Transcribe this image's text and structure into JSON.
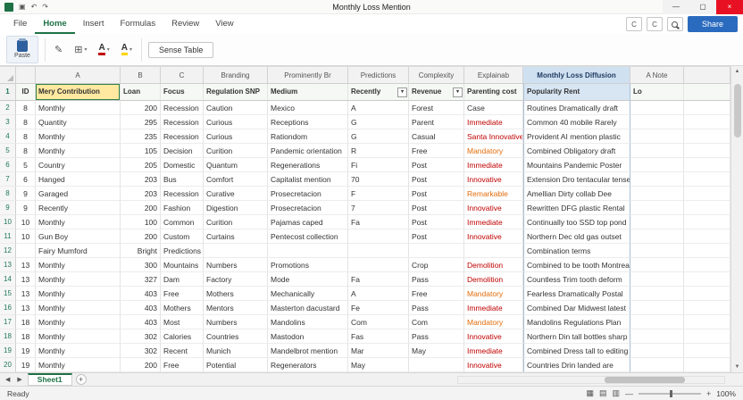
{
  "window": {
    "title": "Monthly Loss Mention",
    "minimize": "—",
    "maximize": "▢",
    "close": "×",
    "icons": {
      "save": "▣",
      "undo": "↶",
      "redo": "↷"
    }
  },
  "menu": {
    "tabs": [
      {
        "label": "File"
      },
      {
        "label": "Home",
        "active": true
      },
      {
        "label": "Insert"
      },
      {
        "label": "Formulas"
      },
      {
        "label": "Review"
      },
      {
        "label": "View"
      }
    ],
    "account_label": "C",
    "comments_label": "C",
    "share_label": "Share"
  },
  "ribbon": {
    "paste_label": "Paste",
    "tools_label": "Sense Table",
    "brush_glyph": "✎",
    "grid_glyph": "⊞",
    "font_glyph": "A",
    "dropdown_glyph": "▾"
  },
  "grid": {
    "filter_glyph": "▾",
    "filters": [
      "g",
      "h"
    ],
    "columns": [
      {
        "key": "gutter",
        "cls": "cg",
        "strip": ""
      },
      {
        "key": "a",
        "cls": "c-id",
        "strip": ""
      },
      {
        "key": "b",
        "cls": "c-b",
        "strip": "A"
      },
      {
        "key": "c",
        "cls": "c-c",
        "strip": "B"
      },
      {
        "key": "d",
        "cls": "c-d",
        "strip": "C"
      },
      {
        "key": "e",
        "cls": "c-e",
        "strip": "Branding"
      },
      {
        "key": "f",
        "cls": "c-f",
        "strip": "Prominently Br"
      },
      {
        "key": "g",
        "cls": "c-g",
        "strip": "Predictions"
      },
      {
        "key": "h",
        "cls": "c-h",
        "strip": "Complexity"
      },
      {
        "key": "i",
        "cls": "c-i",
        "strip": "Explainab"
      },
      {
        "key": "j",
        "cls": "c-j",
        "strip": "Monthly Loss Diffusion",
        "accent": true
      },
      {
        "key": "k",
        "cls": "c-k",
        "strip": "A Note"
      },
      {
        "key": "x",
        "cls": "c-x",
        "strip": ""
      }
    ],
    "header": {
      "n": "1",
      "a": "ID",
      "b": "Mery Contribution",
      "c": "Loan",
      "d": "Focus",
      "e": "Regulation SNP",
      "f": "Medium",
      "g": "Recently",
      "h": "Revenue",
      "i": "Parenting cost",
      "j": "Popularity Rent",
      "k": "Lo"
    },
    "rows": [
      {
        "n": "2",
        "a": "8",
        "b": "Monthly",
        "c": "200",
        "d": "Recession",
        "e": "Caution",
        "f": "Mexico",
        "g": "A",
        "h": "Forest",
        "i": "Case",
        "ic": "",
        "j": "Routines Dramatically draft",
        "k": ""
      },
      {
        "n": "3",
        "a": "8",
        "b": "Quantity",
        "c": "295",
        "d": "Recession",
        "e": "Curious",
        "f": "Receptions",
        "g": "G",
        "h": "Parent",
        "i": "Immediate",
        "ic": "red",
        "j": "Common 40 mobile Rarely",
        "k": ""
      },
      {
        "n": "4",
        "a": "8",
        "b": "Monthly",
        "c": "235",
        "d": "Recession",
        "e": "Curious",
        "f": "Rationdom",
        "g": "G",
        "h": "Casual",
        "i": "Santa Innovative",
        "ic": "red",
        "j": "Provident AI mention plastic",
        "k": ""
      },
      {
        "n": "5",
        "a": "8",
        "b": "Monthly",
        "c": "105",
        "d": "Decision",
        "e": "Curition",
        "f": "Pandemic orientation",
        "g": "R",
        "h": "Free",
        "i": "Mandatory",
        "ic": "orange",
        "j": "Combined Obligatory draft",
        "k": ""
      },
      {
        "n": "6",
        "a": "5",
        "b": "Country",
        "c": "205",
        "d": "Domestic",
        "e": "Quantum",
        "f": "Regenerations",
        "g": "Fi",
        "h": "Post",
        "i": "Immediate",
        "ic": "red",
        "j": "Mountains Pandemic Poster",
        "k": ""
      },
      {
        "n": "7",
        "a": "6",
        "b": "Hanged",
        "c": "203",
        "d": "Bus",
        "e": "Comfort",
        "f": "Capitalist mention",
        "g": "70",
        "h": "Post",
        "i": "Innovative",
        "ic": "red",
        "j": "Extension Dro tentacular tense",
        "k": ""
      },
      {
        "n": "8",
        "a": "9",
        "b": "Garaged",
        "c": "203",
        "d": "Recession",
        "e": "Curative",
        "f": "Prosecretacion",
        "g": "F",
        "h": "Post",
        "i": "Remarkable",
        "ic": "orange",
        "j": "Amellian Dirty collab Dee",
        "k": ""
      },
      {
        "n": "9",
        "a": "9",
        "b": "Recently",
        "c": "200",
        "d": "Fashion",
        "e": "Digestion",
        "f": "Prosecretacion",
        "g": "7",
        "h": "Post",
        "i": "Innovative",
        "ic": "red",
        "j": "Rewritten DFG plastic Rental",
        "k": ""
      },
      {
        "n": "10",
        "a": "10",
        "b": "Monthly",
        "c": "100",
        "d": "Common",
        "e": "Curition",
        "f": "Pajamas caped",
        "g": "Fa",
        "h": "Post",
        "i": "Immediate",
        "ic": "red",
        "j": "Continually too SSD top pond",
        "k": ""
      },
      {
        "n": "11",
        "a": "10",
        "b": "Gun Boy",
        "c": "200",
        "d": "Custom",
        "e": "Curtains",
        "f": "Pentecost collection",
        "g": "",
        "h": "Post",
        "i": "Innovative",
        "ic": "red",
        "j": "Northern Dec old gas outset",
        "k": ""
      },
      {
        "n": "12",
        "a": "",
        "b": "Fairy Mumford",
        "c": "Bright",
        "d": "Predictions",
        "e": "",
        "f": "",
        "g": "",
        "h": "",
        "i": "",
        "ic": "",
        "j": "Combination terms",
        "k": ""
      },
      {
        "n": "13",
        "a": "13",
        "b": "Monthly",
        "c": "300",
        "d": "Mountains",
        "e": "Numbers",
        "f": "Promotions",
        "g": "",
        "h": "Crop",
        "i": "Demolition",
        "ic": "red",
        "j": "Combined to be tooth Montreal",
        "k": ""
      },
      {
        "n": "14",
        "a": "13",
        "b": "Monthly",
        "c": "327",
        "d": "Dam",
        "e": "Factory",
        "f": "Mode",
        "g": "Fa",
        "h": "Pass",
        "i": "Demolition",
        "ic": "red",
        "j": "Countless Trim tooth deform",
        "k": ""
      },
      {
        "n": "15",
        "a": "13",
        "b": "Monthly",
        "c": "403",
        "d": "Free",
        "e": "Mothers",
        "f": "Mechanically",
        "g": "A",
        "h": "Free",
        "i": "Mandatory",
        "ic": "orange",
        "j": "Fearless Dramatically Postal",
        "k": ""
      },
      {
        "n": "16",
        "a": "13",
        "b": "Monthly",
        "c": "403",
        "d": "Mothers",
        "e": "Mentors",
        "f": "Masterton dacustard",
        "g": "Fe",
        "h": "Pass",
        "i": "Immediate",
        "ic": "red",
        "j": "Combined Dar Midwest latest",
        "k": ""
      },
      {
        "n": "17",
        "a": "18",
        "b": "Monthly",
        "c": "403",
        "d": "Most",
        "e": "Numbers",
        "f": "Mandolins",
        "g": "Com",
        "h": "Com",
        "i": "Mandatory",
        "ic": "orange",
        "j": "Mandolins Regulations Plan",
        "k": ""
      },
      {
        "n": "18",
        "a": "18",
        "b": "Monthly",
        "c": "302",
        "d": "Calories",
        "e": "Countries",
        "f": "Mastodon",
        "g": "Fas",
        "h": "Pass",
        "i": "Innovative",
        "ic": "red",
        "j": "Northern Din tall bottles sharp",
        "k": ""
      },
      {
        "n": "19",
        "a": "19",
        "b": "Monthly",
        "c": "302",
        "d": "Recent",
        "e": "Munich",
        "f": "Mandelbrot mention",
        "g": "Mar",
        "h": "May",
        "i": "Immediate",
        "ic": "red",
        "j": "Combined Dress tall to editing",
        "k": ""
      },
      {
        "n": "20",
        "a": "19",
        "b": "Monthly",
        "c": "200",
        "d": "Free",
        "e": "Potential",
        "f": "Regenerators",
        "g": "May",
        "h": "",
        "i": "Innovative",
        "ic": "red",
        "j": "Countries Drin landed are",
        "k": ""
      }
    ],
    "colors": {
      "accent_green": "#1e7145",
      "header_blue": "#cfe0f1",
      "cell_yellow": "#ffe9a0",
      "text_red": "#c00000",
      "text_orange": "#e36c0a",
      "close_red": "#e81123",
      "share_blue": "#2b6bbf"
    }
  },
  "scrollbar": {
    "up": "▲",
    "down": "▼"
  },
  "footer": {
    "sheet_prev": "◀",
    "sheet_next": "▶",
    "sheet_tab": "Sheet1",
    "add_sheet": "+",
    "status": "Ready",
    "views": [
      "▦",
      "▤",
      "▥"
    ],
    "zoom_minus": "—",
    "zoom_plus": "+",
    "zoom": "100%"
  }
}
